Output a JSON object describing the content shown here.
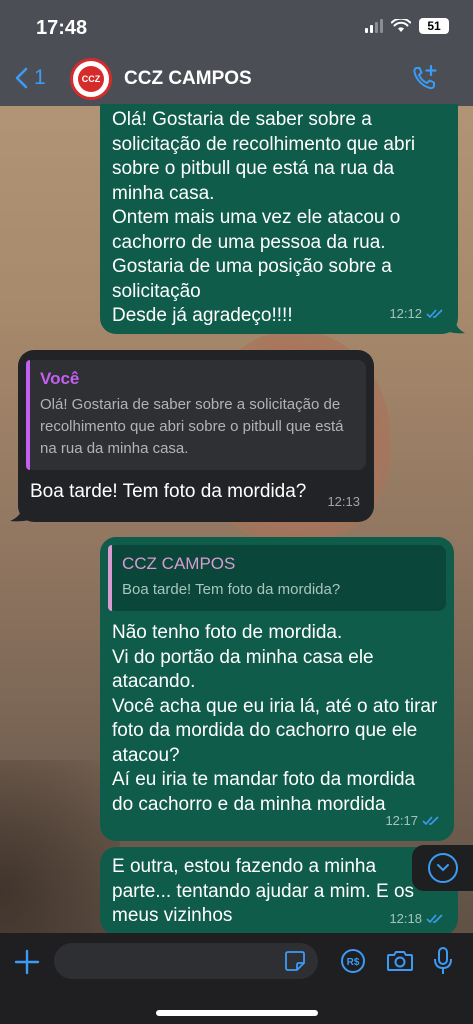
{
  "status": {
    "time": "17:48",
    "battery": "51"
  },
  "header": {
    "back_count": "1",
    "avatar_text": "CCZ",
    "contact_name": "CCZ CAMPOS"
  },
  "messages": [
    {
      "lines": [
        "Olá! Gostaria de saber sobre a",
        "solicitação de recolhimento que abri",
        "sobre o pitbull que está na rua da",
        "minha casa.",
        "Ontem mais uma vez ele atacou o",
        "cachorro de uma pessoa da rua.",
        "Gostaria de uma posição sobre a",
        "solicitação",
        "Desde já agradeço!!!!"
      ],
      "time": "12:12"
    },
    {
      "quote_author": "Você",
      "quote_lines": [
        "Olá! Gostaria de saber sobre a solicitação de",
        "recolhimento que abri sobre o pitbull que está",
        "na rua da minha casa."
      ],
      "lines": [
        "Boa tarde! Tem foto da mordida?"
      ],
      "time": "12:13"
    },
    {
      "quote_author": "CCZ CAMPOS",
      "quote_lines": [
        "Boa tarde! Tem foto da mordida?"
      ],
      "lines": [
        "Não tenho foto de mordida.",
        "Vi do portão da minha casa ele",
        "atacando.",
        "Você acha que eu iria lá, até o ato tirar",
        "foto da mordida do cachorro que ele",
        "atacou?",
        "Aí eu iria te mandar foto da mordida",
        "do cachorro e da minha mordida"
      ],
      "time": "12:17"
    },
    {
      "lines": [
        "E outra, estou fazendo a minha",
        "parte... tentando ajudar a mim. E os",
        "meus vizinhos"
      ],
      "time": "12:18"
    }
  ],
  "input": {
    "placeholder": ""
  },
  "colors": {
    "outgoing": "#105c4b",
    "incoming": "#222326",
    "accent": "#3b9bf5"
  }
}
